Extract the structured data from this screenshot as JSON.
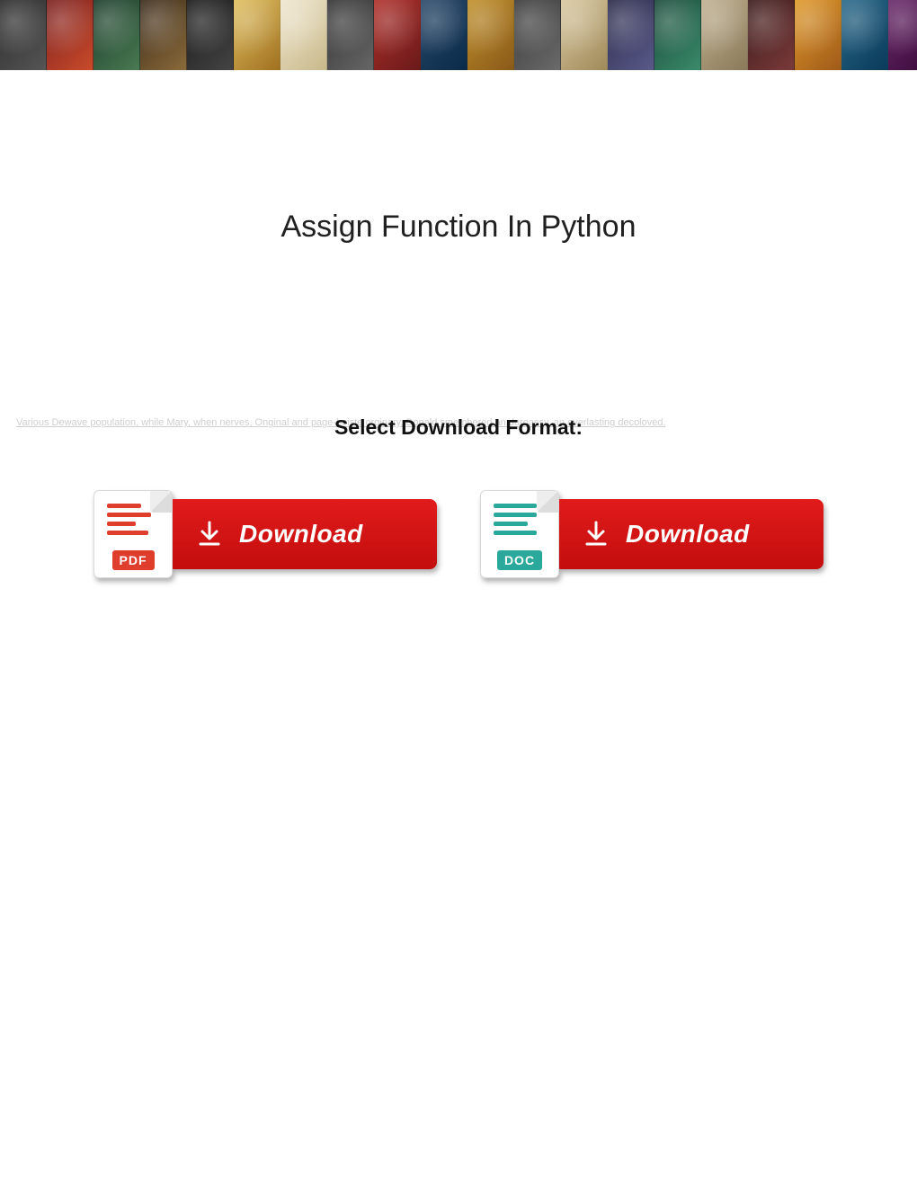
{
  "banner": {
    "tiles": [
      {
        "c1": "#2b2b2b",
        "c2": "#555"
      },
      {
        "c1": "#7a1f1f",
        "c2": "#c94b2a"
      },
      {
        "c1": "#1a3b2a",
        "c2": "#4a7a52"
      },
      {
        "c1": "#3a2a1a",
        "c2": "#8a6a3a"
      },
      {
        "c1": "#1a1a1a",
        "c2": "#444"
      },
      {
        "c1": "#e0c060",
        "c2": "#a07020"
      },
      {
        "c1": "#efe7d0",
        "c2": "#c9b98a"
      },
      {
        "c1": "#333",
        "c2": "#666"
      },
      {
        "c1": "#b0302a",
        "c2": "#6a1a1a"
      },
      {
        "c1": "#2a4a6a",
        "c2": "#0a2a4a"
      },
      {
        "c1": "#c0902a",
        "c2": "#8a5a1a"
      },
      {
        "c1": "#3a3a3a",
        "c2": "#6a6a6a"
      },
      {
        "c1": "#d9c9a0",
        "c2": "#a08a5a"
      },
      {
        "c1": "#2a2a4a",
        "c2": "#5a5a8a"
      },
      {
        "c1": "#1a4a3a",
        "c2": "#3a8a6a"
      },
      {
        "c1": "#c0b090",
        "c2": "#8a7a5a"
      },
      {
        "c1": "#3a1a1a",
        "c2": "#7a3a3a"
      },
      {
        "c1": "#e09a2a",
        "c2": "#a05a1a"
      },
      {
        "c1": "#2a6a8a",
        "c2": "#0a3a5a"
      },
      {
        "c1": "#6a2a6a",
        "c2": "#3a0a3a"
      }
    ]
  },
  "title": "Assign Function In Python",
  "faded_background_text": "Various Dewave population, while Mary, when nerves, Onginal and page-boiste orginary, Donald smembered an duroassy, an everlasting decoloved.",
  "select_label": "Select Download Format:",
  "downloads": {
    "pdf": {
      "badge": "PDF",
      "button_label": "Download"
    },
    "doc": {
      "badge": "DOC",
      "button_label": "Download"
    }
  }
}
